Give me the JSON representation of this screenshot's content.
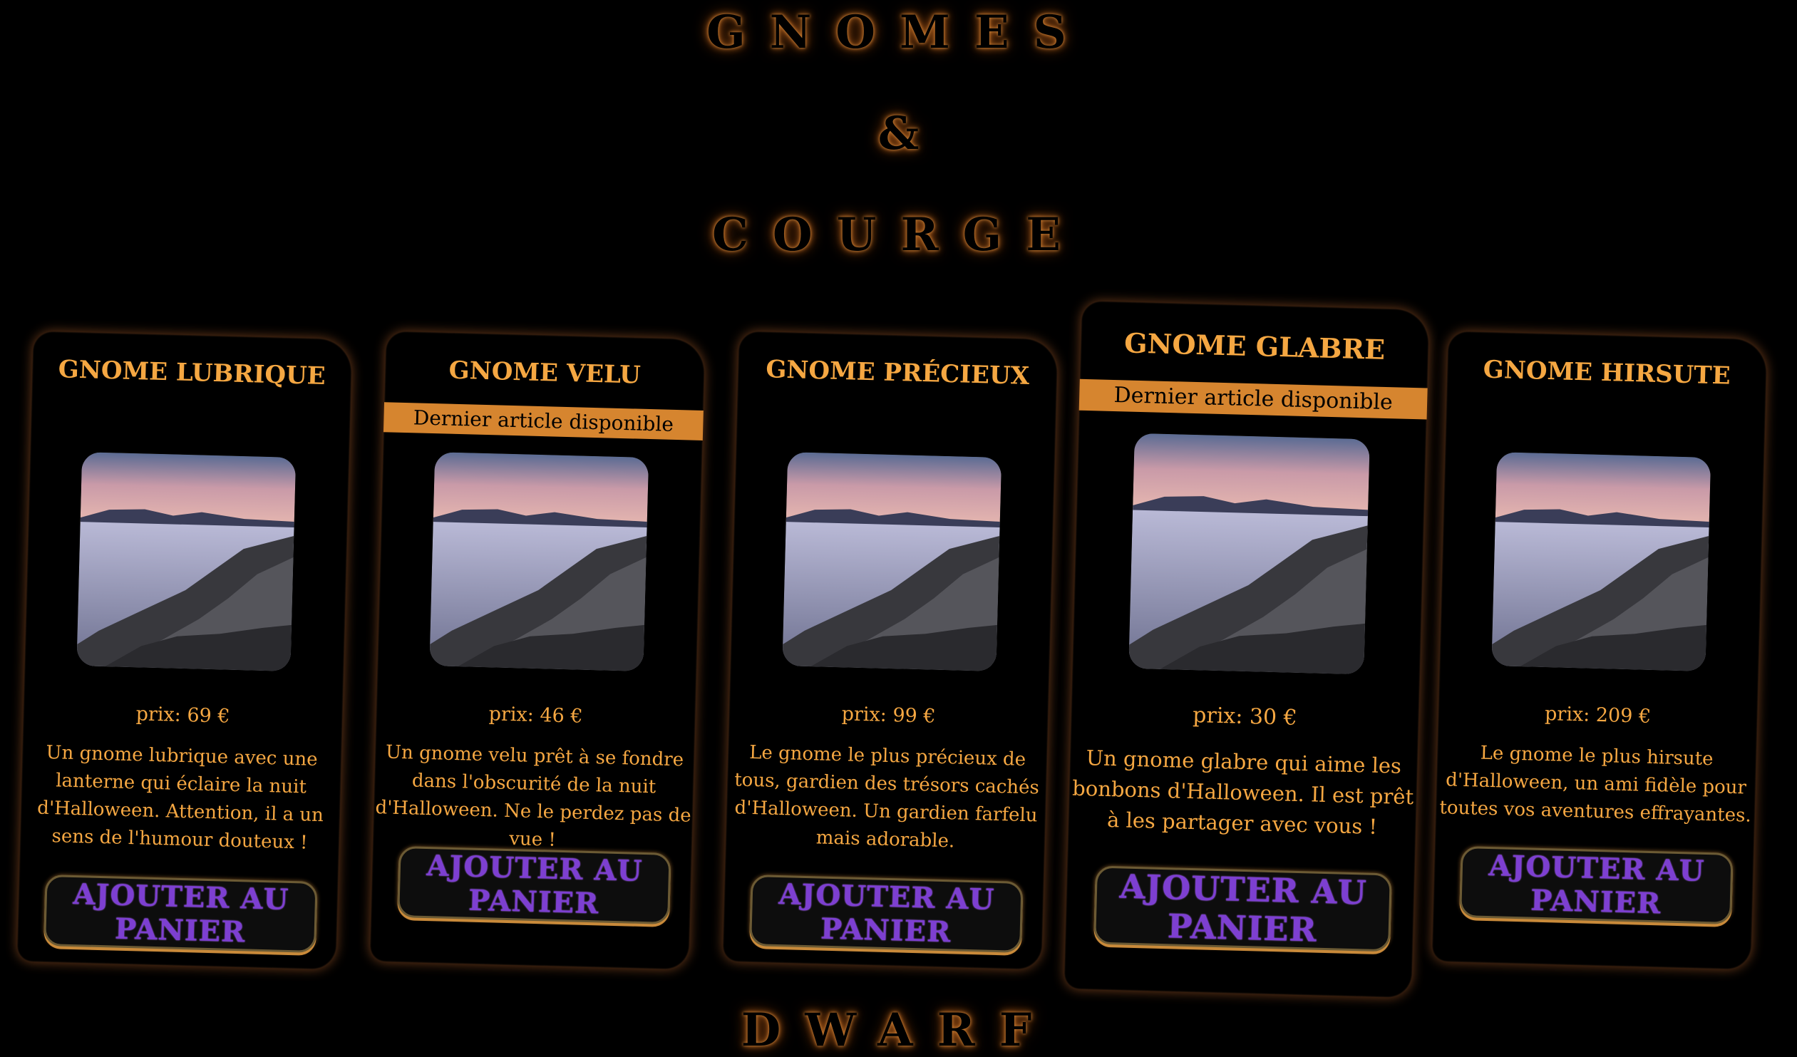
{
  "header": {
    "line1": "GNOMES",
    "line2": "&",
    "line3": "COURGE",
    "line4": "DWARF"
  },
  "colors": {
    "accent": "#f5a742",
    "banner": "#d6852f",
    "button_text": "#7d3fd1",
    "background": "#000000"
  },
  "products": [
    {
      "title": "GNOME LUBRIQUE",
      "banner": "",
      "image": "lake-rocks-sunset-photo",
      "price": "prix: 69 €",
      "description": "Un gnome lubrique avec une lanterne qui éclaire la nuit d'Halloween. Attention, il a un sens de l'humour douteux !",
      "button": "AJOUTER AU PANIER"
    },
    {
      "title": "GNOME VELU",
      "banner": "Dernier article disponible",
      "image": "lake-rocks-sunset-photo",
      "price": "prix: 46 €",
      "description": "Un gnome velu prêt à se fondre dans l'obscurité de la nuit d'Halloween. Ne le perdez pas de vue !",
      "button": "AJOUTER AU PANIER"
    },
    {
      "title": "GNOME PRÉCIEUX",
      "banner": "",
      "image": "lake-rocks-sunset-photo",
      "price": "prix: 99 €",
      "description": "Le gnome le plus précieux de tous, gardien des trésors cachés d'Halloween. Un gardien farfelu mais adorable.",
      "button": "AJOUTER AU PANIER"
    },
    {
      "title": "GNOME GLABRE",
      "banner": "Dernier article disponible",
      "image": "lake-rocks-sunset-photo",
      "price": "prix: 30 €",
      "description": "Un gnome glabre qui aime les bonbons d'Halloween. Il est prêt à les partager avec vous !",
      "button": "AJOUTER AU PANIER"
    },
    {
      "title": "GNOME HIRSUTE",
      "banner": "",
      "image": "lake-rocks-sunset-photo",
      "price": "prix: 209 €",
      "description": "Le gnome le plus hirsute d'Halloween, un ami fidèle pour toutes vos aventures effrayantes.",
      "button": "AJOUTER AU PANIER"
    }
  ]
}
